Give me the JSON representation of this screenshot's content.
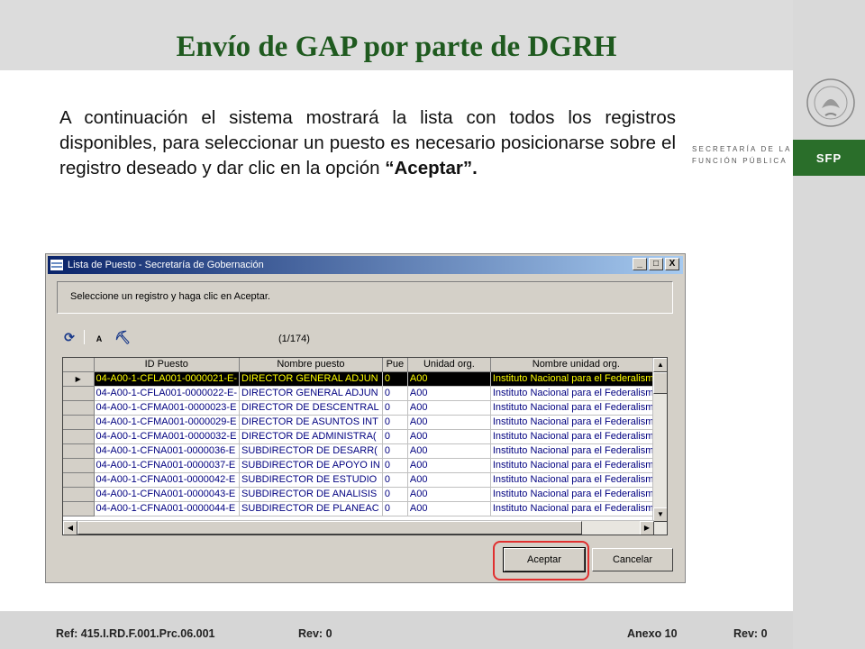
{
  "slide": {
    "title": "Envío de GAP por parte de DGRH",
    "paragraph_main": "A continuación el sistema mostrará la lista con todos los registros disponibles, para seleccionar un puesto es necesario posicionarse sobre el registro deseado y dar clic en la opción ",
    "paragraph_bold": "“Aceptar”.",
    "logo": {
      "line1": "SECRETARÍA DE LA",
      "line2": "FUNCIÓN PÚBLICA",
      "badge": "SFP",
      "seal_icon": "mexico-coat-of-arms-icon",
      "brand_color": "#2a6e2a"
    }
  },
  "window": {
    "title": "Lista de Puesto - Secretaría de Gobernación",
    "controls": [
      "_",
      "□",
      "X"
    ],
    "instruction": "Seleccione un registro y haga clic en Aceptar.",
    "toolbar": {
      "icons": [
        "refresh-icon",
        "sort-az-icon",
        "binoculars-icon"
      ],
      "glyphs": [
        "⟳",
        "↓",
        "♜"
      ]
    },
    "record_count": "(1/174)",
    "grid": {
      "columns": [
        "ID Puesto",
        "Nombre puesto",
        "Pue",
        "Unidad org.",
        "Nombre unidad org."
      ],
      "rows": [
        [
          "04-A00-1-CFLA001-0000021-E-",
          "DIRECTOR GENERAL ADJUN",
          "0",
          "A00",
          "Instituto Nacional para el Federalismo"
        ],
        [
          "04-A00-1-CFLA001-0000022-E-",
          "DIRECTOR GENERAL ADJUN",
          "0",
          "A00",
          "Instituto Nacional para el Federalismo"
        ],
        [
          "04-A00-1-CFMA001-0000023-E",
          "DIRECTOR DE DESCENTRAL",
          "0",
          "A00",
          "Instituto Nacional para el Federalismo"
        ],
        [
          "04-A00-1-CFMA001-0000029-E",
          "DIRECTOR DE ASUNTOS INT",
          "0",
          "A00",
          "Instituto Nacional para el Federalismo"
        ],
        [
          "04-A00-1-CFMA001-0000032-E",
          "DIRECTOR DE ADMINISTRA(",
          "0",
          "A00",
          "Instituto Nacional para el Federalismo"
        ],
        [
          "04-A00-1-CFNA001-0000036-E",
          "SUBDIRECTOR DE DESARR(",
          "0",
          "A00",
          "Instituto Nacional para el Federalismo"
        ],
        [
          "04-A00-1-CFNA001-0000037-E",
          "SUBDIRECTOR DE APOYO IN",
          "0",
          "A00",
          "Instituto Nacional para el Federalismo"
        ],
        [
          "04-A00-1-CFNA001-0000042-E",
          "SUBDIRECTOR DE ESTUDIO",
          "0",
          "A00",
          "Instituto Nacional para el Federalismo"
        ],
        [
          "04-A00-1-CFNA001-0000043-E",
          "SUBDIRECTOR DE ANALISIS",
          "0",
          "A00",
          "Instituto Nacional para el Federalismo"
        ],
        [
          "04-A00-1-CFNA001-0000044-E",
          "SUBDIRECTOR DE PLANEAC",
          "0",
          "A00",
          "Instituto Nacional para el Federalismo"
        ]
      ],
      "selected_row_index": 0,
      "selection_colors": {
        "background": "#000000",
        "text": "#ffff00"
      },
      "cell_text_color": "#000080"
    },
    "buttons": {
      "accept": "Aceptar",
      "cancel": "Cancelar"
    },
    "highlight_color": "#e03030"
  },
  "footer": {
    "ref": "Ref: 415.I.RD.F.001.Prc.06.001",
    "rev1": "Rev: 0",
    "annex": "Anexo 10",
    "rev2": "Rev: 0"
  }
}
